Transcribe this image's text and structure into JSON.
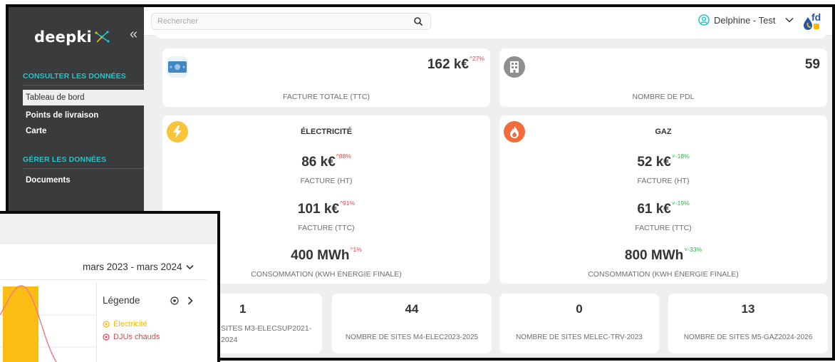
{
  "app": {
    "logo_text": "deepki",
    "collapse_label": "«"
  },
  "sidebar": {
    "section_consult": "CONSULTER LES DONNÉES",
    "items_consult": [
      {
        "label": "Tableau de bord",
        "active": true
      },
      {
        "label": "Points de livraison",
        "active": false
      },
      {
        "label": "Carte",
        "active": false
      }
    ],
    "section_manage": "GÉRER LES DONNÉES",
    "items_manage": [
      {
        "label": "Documents",
        "active": false
      }
    ]
  },
  "topbar": {
    "search_placeholder": "Rechercher",
    "search_icon": "search-icon",
    "user_name": "Delphine - Test",
    "user_icon": "user-circle-icon",
    "brand_text": "fd"
  },
  "summary": {
    "total_bill": {
      "value": "162 k€",
      "delta": "^27%",
      "trend": "up",
      "caption": "FACTURE TOTALE (TTC)"
    },
    "pdl_count": {
      "value": "59",
      "caption": "NOMBRE DE PDL"
    }
  },
  "electricity": {
    "title": "ÉLECTRICITÉ",
    "metrics": [
      {
        "value": "86 k€",
        "delta": "^88%",
        "trend": "up",
        "caption": "FACTURE (HT)"
      },
      {
        "value": "101 k€",
        "delta": "^91%",
        "trend": "up",
        "caption": "FACTURE (TTC)"
      },
      {
        "value": "400 MWh",
        "delta": "^1%",
        "trend": "up",
        "caption": "CONSOMMATION (KWH ÉNERGIE FINALE)"
      }
    ]
  },
  "gas": {
    "title": "GAZ",
    "metrics": [
      {
        "value": "52 k€",
        "delta": "˅-18%",
        "trend": "down",
        "caption": "FACTURE (HT)"
      },
      {
        "value": "61 k€",
        "delta": "˅-19%",
        "trend": "down",
        "caption": "FACTURE (TTC)"
      },
      {
        "value": "800 MWh",
        "delta": "˅-33%",
        "trend": "down",
        "caption": "CONSOMMATION (KWH ÉNERGIE FINALE)"
      }
    ]
  },
  "sites": [
    {
      "value": "1",
      "caption_line1": "SITES M3-ELECSUP2021-",
      "caption_line2": "2024"
    },
    {
      "value": "44",
      "caption_line1": "NOMBRE DE SITES M4-ELEC2023-2025",
      "caption_line2": ""
    },
    {
      "value": "0",
      "caption_line1": "NOMBRE DE SITES MELEC-TRV-2023",
      "caption_line2": ""
    },
    {
      "value": "13",
      "caption_line1": "NOMBRE DE SITES M5-GAZ2024-2026",
      "caption_line2": ""
    }
  ],
  "chart_panel": {
    "period": "mars 2023 - mars 2024",
    "legend_title": "Légende",
    "legend_items": [
      {
        "label": "Électricité",
        "color": "#f5b800"
      },
      {
        "label": "DJUs chauds",
        "color": "#e3424a"
      }
    ]
  },
  "colors": {
    "sidebar_bg": "#3a3b3d",
    "accent_teal": "#27c2c9",
    "up_red": "#e3424a",
    "down_green": "#2db548",
    "elec_yellow": "#f8c43a",
    "gas_orange": "#f26b3a"
  }
}
